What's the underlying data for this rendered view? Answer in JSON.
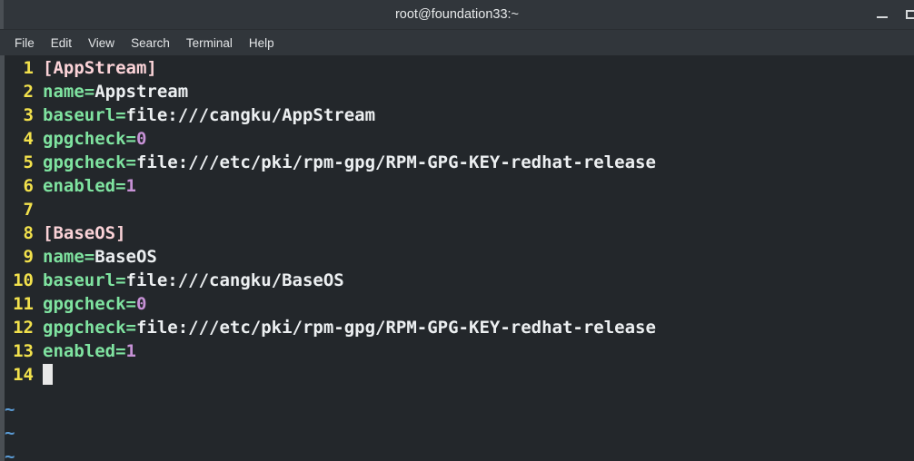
{
  "window": {
    "title": "root@foundation33:~",
    "controls": [
      {
        "name": "minimize-button",
        "label": "–"
      },
      {
        "name": "maximize-button",
        "label": "❐"
      }
    ]
  },
  "menubar": {
    "items": [
      {
        "label": "File"
      },
      {
        "label": "Edit"
      },
      {
        "label": "View"
      },
      {
        "label": "Search"
      },
      {
        "label": "Terminal"
      },
      {
        "label": "Help"
      }
    ]
  },
  "editor": {
    "lines": [
      {
        "number": "1",
        "tokens": [
          {
            "text": "[AppStream]",
            "type": "section"
          }
        ]
      },
      {
        "number": "2",
        "tokens": [
          {
            "text": "name=",
            "type": "key"
          },
          {
            "text": "Appstream",
            "type": "value"
          }
        ]
      },
      {
        "number": "3",
        "tokens": [
          {
            "text": "baseurl=",
            "type": "key"
          },
          {
            "text": "file:///cangku/AppStream",
            "type": "value"
          }
        ]
      },
      {
        "number": "4",
        "tokens": [
          {
            "text": "gpgcheck=",
            "type": "key"
          },
          {
            "text": "0",
            "type": "number"
          }
        ]
      },
      {
        "number": "5",
        "tokens": [
          {
            "text": "gpgcheck=",
            "type": "key"
          },
          {
            "text": "file:///etc/pki/rpm-gpg/RPM-GPG-KEY-redhat-release",
            "type": "value"
          }
        ]
      },
      {
        "number": "6",
        "tokens": [
          {
            "text": "enabled=",
            "type": "key"
          },
          {
            "text": "1",
            "type": "number"
          }
        ]
      },
      {
        "number": "7",
        "tokens": []
      },
      {
        "number": "8",
        "tokens": [
          {
            "text": "[BaseOS]",
            "type": "section"
          }
        ]
      },
      {
        "number": "9",
        "tokens": [
          {
            "text": "name=",
            "type": "key"
          },
          {
            "text": "BaseOS",
            "type": "value"
          }
        ]
      },
      {
        "number": "10",
        "tokens": [
          {
            "text": "baseurl=",
            "type": "key"
          },
          {
            "text": "file:///cangku/BaseOS",
            "type": "value"
          }
        ]
      },
      {
        "number": "11",
        "tokens": [
          {
            "text": "gpgcheck=",
            "type": "key"
          },
          {
            "text": "0",
            "type": "number"
          }
        ]
      },
      {
        "number": "12",
        "tokens": [
          {
            "text": "gpgcheck=",
            "type": "key"
          },
          {
            "text": "file:///etc/pki/rpm-gpg/RPM-GPG-KEY-redhat-release",
            "type": "value"
          }
        ]
      },
      {
        "number": "13",
        "tokens": [
          {
            "text": "enabled=",
            "type": "key"
          },
          {
            "text": "1",
            "type": "number"
          }
        ]
      },
      {
        "number": "14",
        "tokens": [],
        "cursor": true
      }
    ],
    "empty_line_markers": [
      "~",
      "~",
      "~"
    ]
  },
  "colors": {
    "titlebar_bg": "#31363b",
    "terminal_bg": "#23272b",
    "line_number": "#f2e14c",
    "section": "#fbd3d8",
    "key": "#7fe3a0",
    "value": "#eceff1",
    "number": "#c792d6",
    "tilde": "#5b9bd5",
    "cursor": "#e8e8e8"
  }
}
